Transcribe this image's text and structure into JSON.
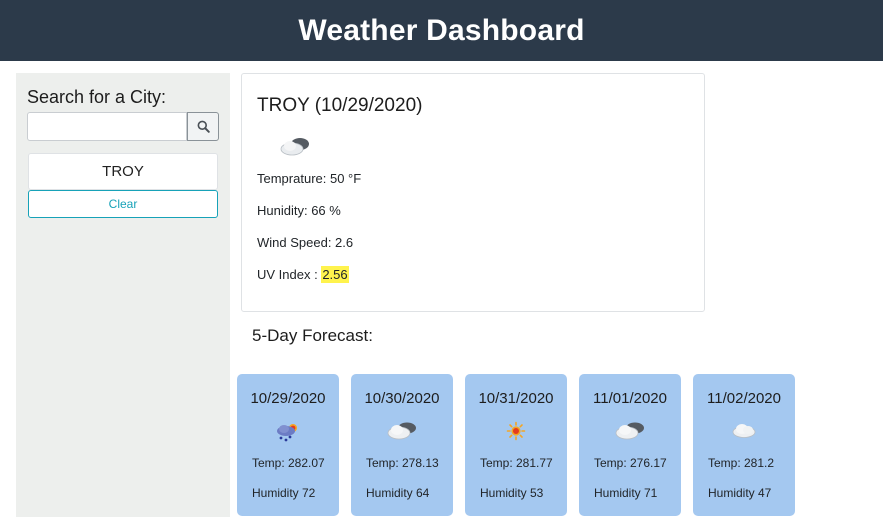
{
  "header": {
    "title": "Weather Dashboard"
  },
  "sidebar": {
    "title": "Search for a City:",
    "search": {
      "value": "",
      "placeholder": "",
      "button_icon": "search-icon"
    },
    "history": [
      {
        "label": "TROY"
      }
    ],
    "clear_label": "Clear"
  },
  "current": {
    "title": "TROY (10/29/2020)",
    "icon": "cloudy-icon",
    "temperature": "Temprature: 50 °F",
    "humidity": "Hunidity: 66 %",
    "wind": "Wind Speed: 2.6",
    "uv_label": "UV Index : ",
    "uv_value": "2.56",
    "uv_color": "#fff34d"
  },
  "forecast": {
    "title": "5-Day Forecast:",
    "days": [
      {
        "date": "10/29/2020",
        "icon": "rain-sun-icon",
        "temp": "Temp: 282.07",
        "humidity": "Humidity 72"
      },
      {
        "date": "10/30/2020",
        "icon": "cloudy-icon",
        "temp": "Temp: 278.13",
        "humidity": "Humidity 64"
      },
      {
        "date": "10/31/2020",
        "icon": "sun-icon",
        "temp": "Temp: 281.77",
        "humidity": "Humidity 53"
      },
      {
        "date": "11/01/2020",
        "icon": "cloudy-icon",
        "temp": "Temp: 276.17",
        "humidity": "Humidity 71"
      },
      {
        "date": "11/02/2020",
        "icon": "cloud-icon",
        "temp": "Temp: 281.2",
        "humidity": "Humidity 47"
      }
    ]
  },
  "colors": {
    "header_bg": "#2c3a4a",
    "sidebar_bg": "#edefed",
    "card_bg": "#a4c8f0",
    "accent": "#17a2b8"
  }
}
